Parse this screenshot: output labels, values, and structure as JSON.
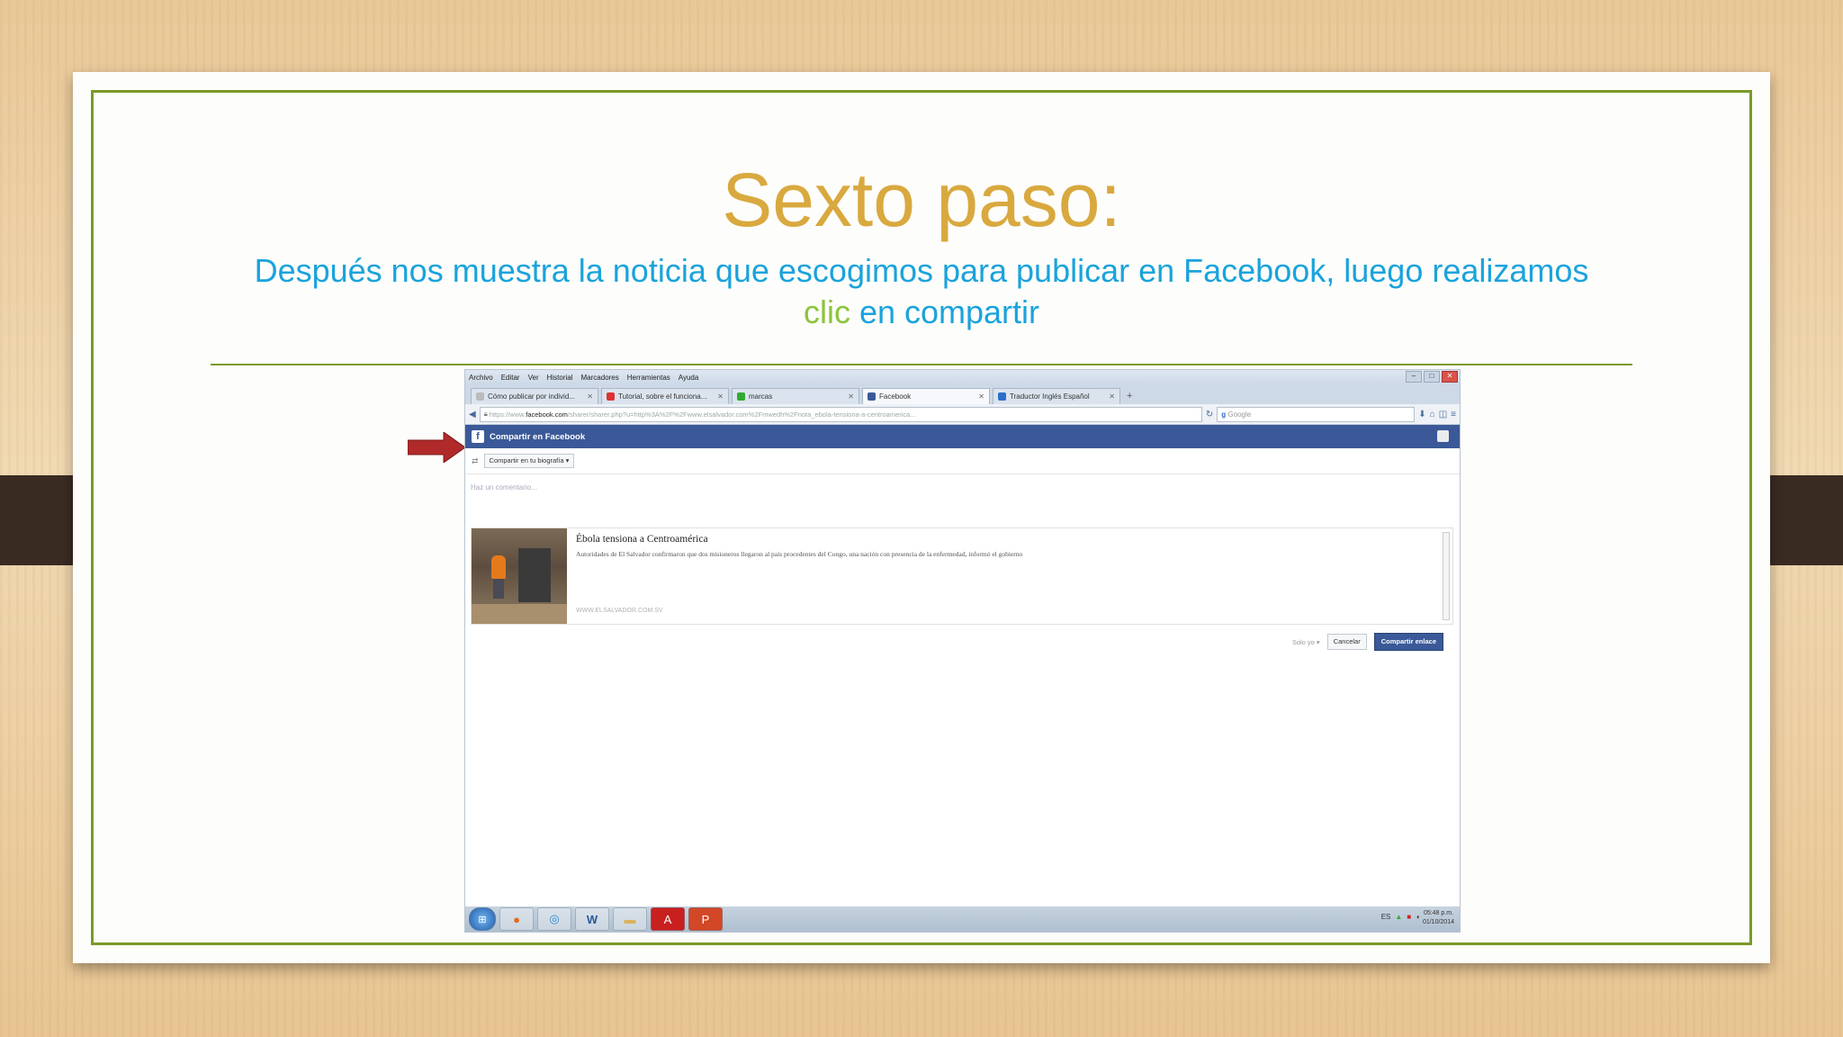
{
  "slide": {
    "title": "Sexto paso:",
    "subtitle_part1": "Después nos muestra la noticia que escogimos para publicar en Facebook, luego realizamos",
    "subtitle_highlight": "clic",
    "subtitle_part2": " en compartir",
    "colors": {
      "title": "#d9a93f",
      "subtitle": "#1aa3dc",
      "highlight": "#8cc43c",
      "frame": "#7a9a2a",
      "arrow": "#b02a2a"
    }
  },
  "browser": {
    "menu": [
      "Archivo",
      "Editar",
      "Ver",
      "Historial",
      "Marcadores",
      "Herramientas",
      "Ayuda"
    ],
    "window_buttons": [
      "–",
      "□",
      "✕"
    ],
    "tabs": [
      {
        "label": "Cómo publicar por individ...",
        "icon": "page-icon"
      },
      {
        "label": "Tutorial, sobre el funciona...",
        "icon": "youtube-icon"
      },
      {
        "label": "marcas",
        "icon": "green-page-icon"
      },
      {
        "label": "Facebook",
        "icon": "facebook-icon"
      },
      {
        "label": "Traductor Inglés Español",
        "icon": "translator-icon"
      }
    ],
    "new_tab": "+",
    "url_prefix": "https://www.",
    "url_domain": "facebook.com",
    "url_rest": "/sharer/sharer.php?u=http%3A%2F%2Fwww.elsalvador.com%2Fmwedh%2Fnota_ebola-tensiona-a-centroamerica...",
    "search_placeholder": "Google"
  },
  "facebook": {
    "header": "Compartir en Facebook",
    "share_dropdown": "Compartir en tu biografía ▾",
    "comment_placeholder": "Haz un comentario...",
    "article": {
      "title": "Ébola tensiona a Centroamérica",
      "description": "Autoridades de El Salvador confirmaron que dos misioneros llegaron al país procedentes del Congo, una nación con presencia de la enfermedad, informó el gobierno",
      "domain": "WWW.ELSALVADOR.COM.SV"
    },
    "audience": "Solo yo ▾",
    "cancel": "Cancelar",
    "share": "Compartir enlace"
  },
  "taskbar": {
    "apps": [
      "windows-start-icon",
      "firefox-icon",
      "chrome-icon",
      "word-icon",
      "folder-icon",
      "acrobat-icon",
      "powerpoint-icon"
    ],
    "lang": "ES",
    "time": "05:48 p.m.",
    "date": "01/10/2014"
  }
}
